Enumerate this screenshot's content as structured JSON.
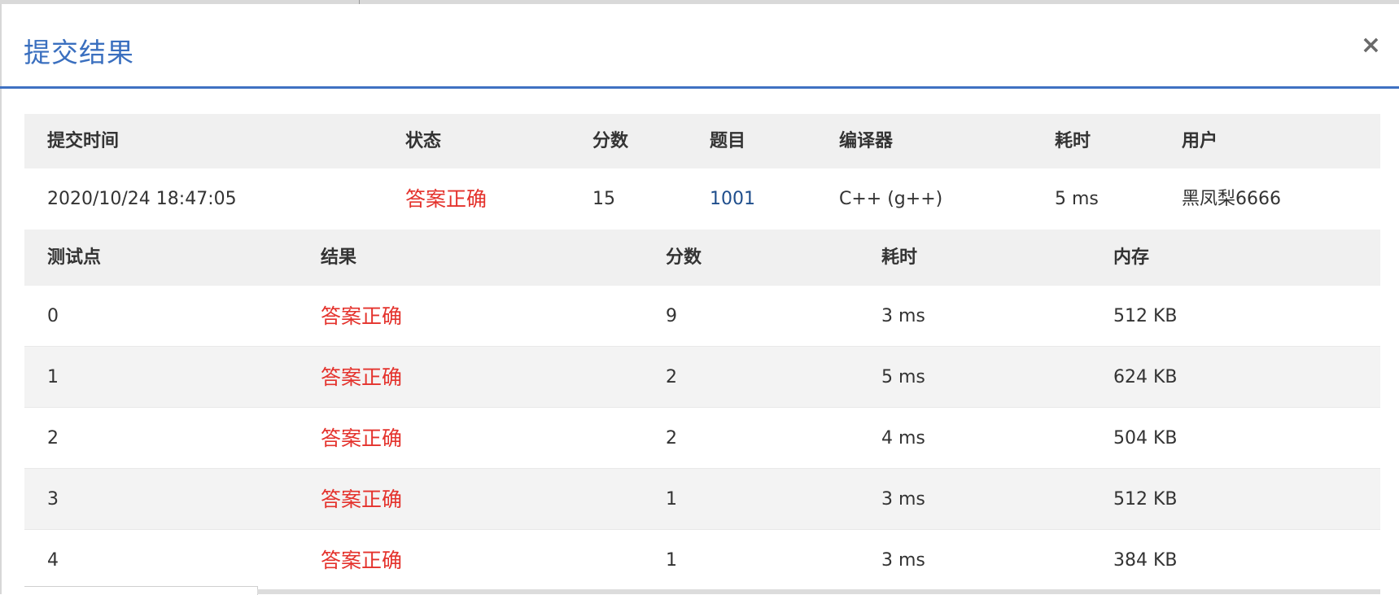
{
  "modal": {
    "title": "提交结果",
    "close_symbol": "×"
  },
  "summary": {
    "headers": [
      "提交时间",
      "状态",
      "分数",
      "题目",
      "编译器",
      "耗时",
      "用户"
    ],
    "row": {
      "time": "2020/10/24 18:47:05",
      "status": "答案正确",
      "score": "15",
      "problem": "1001",
      "compiler": "C++ (g++)",
      "duration": "5 ms",
      "user": "黑凤梨6666"
    }
  },
  "tests": {
    "headers": [
      "测试点",
      "结果",
      "分数",
      "耗时",
      "内存"
    ],
    "rows": [
      {
        "id": "0",
        "result": "答案正确",
        "score": "9",
        "time": "3 ms",
        "memory": "512 KB"
      },
      {
        "id": "1",
        "result": "答案正确",
        "score": "2",
        "time": "5 ms",
        "memory": "624 KB"
      },
      {
        "id": "2",
        "result": "答案正确",
        "score": "2",
        "time": "4 ms",
        "memory": "504 KB"
      },
      {
        "id": "3",
        "result": "答案正确",
        "score": "1",
        "time": "3 ms",
        "memory": "512 KB"
      },
      {
        "id": "4",
        "result": "答案正确",
        "score": "1",
        "time": "3 ms",
        "memory": "384 KB"
      }
    ]
  },
  "colors": {
    "accent": "#3f71c2",
    "success": "#e4322c",
    "link": "#1f4e8c"
  }
}
